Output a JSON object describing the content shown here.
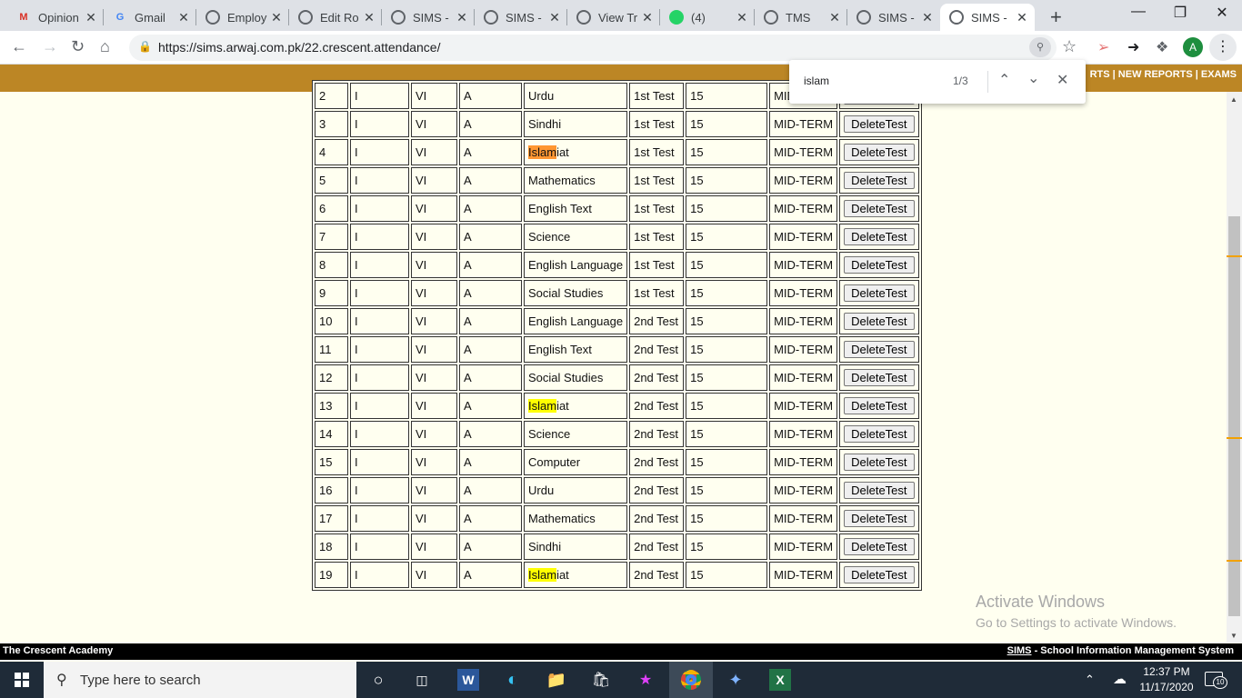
{
  "browser": {
    "tabs": [
      {
        "title": "Opinion",
        "icon": "gmail-icon",
        "icon_text": "M",
        "color": "#d93025"
      },
      {
        "title": "Gmail",
        "icon": "google-icon",
        "icon_text": "G",
        "color": "#4285f4"
      },
      {
        "title": "Employ",
        "icon": "globe-icon",
        "icon_text": "",
        "color": "#5f6368"
      },
      {
        "title": "Edit Ro",
        "icon": "globe-icon",
        "icon_text": "",
        "color": "#5f6368"
      },
      {
        "title": "SIMS -",
        "icon": "globe-icon",
        "icon_text": "",
        "color": "#5f6368"
      },
      {
        "title": "SIMS -",
        "icon": "globe-icon",
        "icon_text": "",
        "color": "#5f6368"
      },
      {
        "title": "View Tr",
        "icon": "globe-icon",
        "icon_text": "",
        "color": "#5f6368"
      },
      {
        "title": "(4)",
        "icon": "whatsapp-icon",
        "icon_text": "",
        "color": "#25d366"
      },
      {
        "title": "TMS",
        "icon": "globe-icon",
        "icon_text": "",
        "color": "#5f6368"
      },
      {
        "title": "SIMS -",
        "icon": "globe-icon",
        "icon_text": "",
        "color": "#5f6368"
      },
      {
        "title": "SIMS -",
        "icon": "globe-icon",
        "icon_text": "",
        "color": "#5f6368",
        "active": true
      }
    ],
    "url": "https://sims.arwaj.com.pk/22.crescent.attendance/",
    "avatar_letter": "A"
  },
  "find_bar": {
    "query": "islam",
    "count": "1/3"
  },
  "site_nav": {
    "links_text": "RTS | NEW REPORTS | EXAMS"
  },
  "table": {
    "first_row": {
      "no": "2",
      "term": "I",
      "class": "VI",
      "section": "A",
      "subject": "Urdu",
      "test": "1st Test",
      "marks": "15",
      "exam": "MID-TERM"
    },
    "button_label": "DeleteTest",
    "rows": [
      {
        "no": "3",
        "term": "I",
        "class": "VI",
        "section": "A",
        "subject": "Sindhi",
        "test": "1st Test",
        "marks": "15",
        "exam": "MID-TERM"
      },
      {
        "no": "4",
        "term": "I",
        "class": "VI",
        "section": "A",
        "subject": "Islamiat",
        "test": "1st Test",
        "marks": "15",
        "exam": "MID-TERM",
        "highlight": "current"
      },
      {
        "no": "5",
        "term": "I",
        "class": "VI",
        "section": "A",
        "subject": "Mathematics",
        "test": "1st Test",
        "marks": "15",
        "exam": "MID-TERM"
      },
      {
        "no": "6",
        "term": "I",
        "class": "VI",
        "section": "A",
        "subject": "English Text",
        "test": "1st Test",
        "marks": "15",
        "exam": "MID-TERM"
      },
      {
        "no": "7",
        "term": "I",
        "class": "VI",
        "section": "A",
        "subject": "Science",
        "test": "1st Test",
        "marks": "15",
        "exam": "MID-TERM"
      },
      {
        "no": "8",
        "term": "I",
        "class": "VI",
        "section": "A",
        "subject": "English Language",
        "test": "1st Test",
        "marks": "15",
        "exam": "MID-TERM"
      },
      {
        "no": "9",
        "term": "I",
        "class": "VI",
        "section": "A",
        "subject": "Social Studies",
        "test": "1st Test",
        "marks": "15",
        "exam": "MID-TERM"
      },
      {
        "no": "10",
        "term": "I",
        "class": "VI",
        "section": "A",
        "subject": "English Language",
        "test": "2nd Test",
        "marks": "15",
        "exam": "MID-TERM"
      },
      {
        "no": "11",
        "term": "I",
        "class": "VI",
        "section": "A",
        "subject": "English Text",
        "test": "2nd Test",
        "marks": "15",
        "exam": "MID-TERM"
      },
      {
        "no": "12",
        "term": "I",
        "class": "VI",
        "section": "A",
        "subject": "Social Studies",
        "test": "2nd Test",
        "marks": "15",
        "exam": "MID-TERM"
      },
      {
        "no": "13",
        "term": "I",
        "class": "VI",
        "section": "A",
        "subject": "Islamiat",
        "test": "2nd Test",
        "marks": "15",
        "exam": "MID-TERM",
        "highlight": "match"
      },
      {
        "no": "14",
        "term": "I",
        "class": "VI",
        "section": "A",
        "subject": "Science",
        "test": "2nd Test",
        "marks": "15",
        "exam": "MID-TERM"
      },
      {
        "no": "15",
        "term": "I",
        "class": "VI",
        "section": "A",
        "subject": "Computer",
        "test": "2nd Test",
        "marks": "15",
        "exam": "MID-TERM"
      },
      {
        "no": "16",
        "term": "I",
        "class": "VI",
        "section": "A",
        "subject": "Urdu",
        "test": "2nd Test",
        "marks": "15",
        "exam": "MID-TERM"
      },
      {
        "no": "17",
        "term": "I",
        "class": "VI",
        "section": "A",
        "subject": "Mathematics",
        "test": "2nd Test",
        "marks": "15",
        "exam": "MID-TERM"
      },
      {
        "no": "18",
        "term": "I",
        "class": "VI",
        "section": "A",
        "subject": "Sindhi",
        "test": "2nd Test",
        "marks": "15",
        "exam": "MID-TERM"
      },
      {
        "no": "19",
        "term": "I",
        "class": "VI",
        "section": "A",
        "subject": "Islamiat",
        "test": "2nd Test",
        "marks": "15",
        "exam": "MID-TERM",
        "highlight": "match"
      }
    ]
  },
  "watermark": {
    "line1": "Activate Windows",
    "line2": "Go to Settings to activate Windows."
  },
  "footer": {
    "left": "The Crescent Academy",
    "right_link": "SIMS",
    "right_text": " - School Information Management System"
  },
  "taskbar": {
    "search_placeholder": "Type here to search",
    "time": "12:37 PM",
    "date": "11/17/2020",
    "notification_count": "10"
  },
  "colors": {
    "site_nav": "#bc8625",
    "page_bg": "#fffff0",
    "highlight": "#ffff00",
    "highlight_current": "#ff9632"
  }
}
